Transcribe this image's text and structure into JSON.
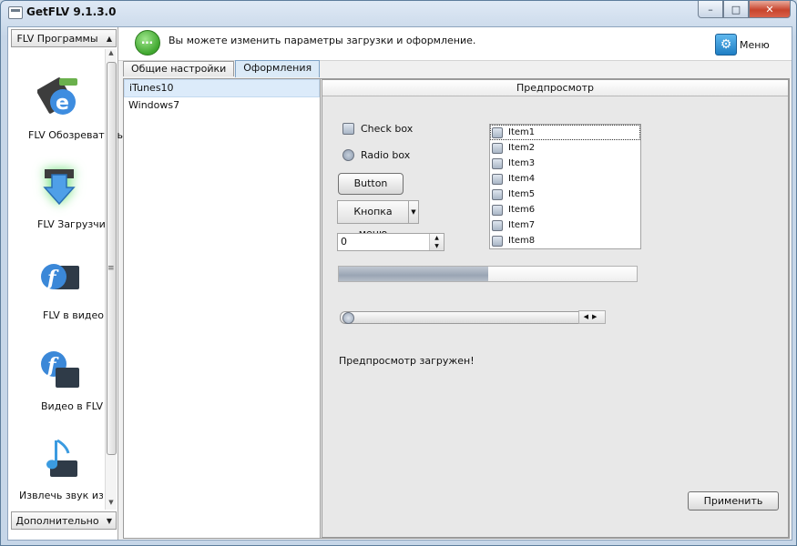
{
  "window": {
    "title": "GetFLV 9.1.3.0",
    "minimize": "–",
    "maximize": "□",
    "close": "✕"
  },
  "sidebar": {
    "header": "FLV Программы",
    "footer": "Дополнительно",
    "items": [
      {
        "label": "FLV Обозреватель",
        "icon": "browser-film-icon"
      },
      {
        "label": "FLV Загрузчик",
        "icon": "download-arrow-icon"
      },
      {
        "label": "FLV в видео",
        "icon": "flash-to-video-icon"
      },
      {
        "label": "Видео в FLV",
        "icon": "video-to-flash-icon"
      },
      {
        "label": "Извлечь звук из FLV",
        "icon": "music-note-icon"
      }
    ]
  },
  "info": {
    "text": "Вы можете изменить параметры загрузки и оформление.",
    "menu_label": "Меню"
  },
  "tabs": [
    {
      "label": "Общие настройки"
    },
    {
      "label": "Оформления"
    }
  ],
  "themes": [
    "iTunes10",
    "Windows7"
  ],
  "preview": {
    "title": "Предпросмотр",
    "checkbox_label": "Check box",
    "radio_label": "Radio box",
    "button_label": "Button",
    "menu_button_label": "Кнопка меню",
    "spinner_value": "0",
    "progress_fraction": 0.5,
    "slider_fraction": 0,
    "status": "Предпросмотр загружен!",
    "list_items": [
      "Item1",
      "Item2",
      "Item3",
      "Item4",
      "Item5",
      "Item6",
      "Item7",
      "Item8"
    ]
  },
  "apply_label": "Применить"
}
